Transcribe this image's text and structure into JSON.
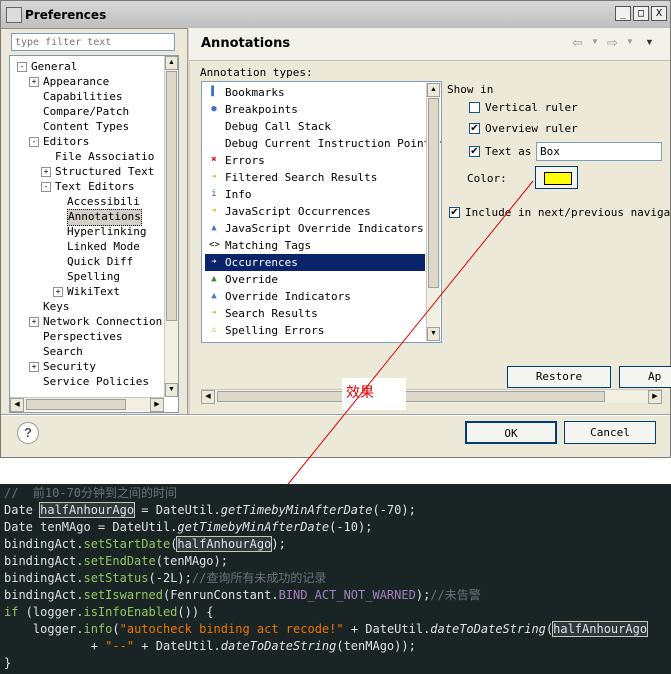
{
  "window": {
    "title": "Preferences",
    "minimize_label": "_",
    "maximize_label": "□",
    "close_label": "X"
  },
  "filter": {
    "placeholder": "type filter text"
  },
  "tree": {
    "items": [
      {
        "label": "General",
        "indent": 1,
        "toggle": "-"
      },
      {
        "label": "Appearance",
        "indent": 2,
        "toggle": "+"
      },
      {
        "label": "Capabilities",
        "indent": 2,
        "toggle": ""
      },
      {
        "label": "Compare/Patch",
        "indent": 2,
        "toggle": ""
      },
      {
        "label": "Content Types",
        "indent": 2,
        "toggle": ""
      },
      {
        "label": "Editors",
        "indent": 2,
        "toggle": "-"
      },
      {
        "label": "File Associatio",
        "indent": 3,
        "toggle": ""
      },
      {
        "label": "Structured Text",
        "indent": 3,
        "toggle": "+"
      },
      {
        "label": "Text Editors",
        "indent": 3,
        "toggle": "-"
      },
      {
        "label": "Accessibili",
        "indent": 4,
        "toggle": ""
      },
      {
        "label": "Annotations",
        "indent": 4,
        "toggle": "",
        "selected": true
      },
      {
        "label": "Hyperlinking",
        "indent": 4,
        "toggle": ""
      },
      {
        "label": "Linked Mode",
        "indent": 4,
        "toggle": ""
      },
      {
        "label": "Quick Diff",
        "indent": 4,
        "toggle": ""
      },
      {
        "label": "Spelling",
        "indent": 4,
        "toggle": ""
      },
      {
        "label": "WikiText",
        "indent": 4,
        "toggle": "+"
      },
      {
        "label": "Keys",
        "indent": 2,
        "toggle": ""
      },
      {
        "label": "Network Connection",
        "indent": 2,
        "toggle": "+"
      },
      {
        "label": "Perspectives",
        "indent": 2,
        "toggle": ""
      },
      {
        "label": "Search",
        "indent": 2,
        "toggle": ""
      },
      {
        "label": "Security",
        "indent": 2,
        "toggle": "+"
      },
      {
        "label": "Service Policies",
        "indent": 2,
        "toggle": ""
      }
    ]
  },
  "page": {
    "title": "Annotations"
  },
  "annotation_types": {
    "label": "Annotation types:",
    "items": [
      {
        "label": "Bookmarks",
        "icon": "bookmark-icon",
        "glyph": "▌",
        "color": "#3c6fc8"
      },
      {
        "label": "Breakpoints",
        "icon": "breakpoint-icon",
        "glyph": "●",
        "color": "#3c6fc8"
      },
      {
        "label": "Debug Call Stack",
        "icon": "",
        "glyph": "",
        "color": "#000000"
      },
      {
        "label": "Debug Current Instruction Pointer",
        "icon": "",
        "glyph": "",
        "color": "#000000"
      },
      {
        "label": "Errors",
        "icon": "error-icon",
        "glyph": "✖",
        "color": "#d42020"
      },
      {
        "label": "Filtered Search Results",
        "icon": "arrow-icon",
        "glyph": "➔",
        "color": "#e0a000"
      },
      {
        "label": "Info",
        "icon": "info-icon",
        "glyph": "i",
        "color": "#2a5db0"
      },
      {
        "label": "JavaScript Occurrences",
        "icon": "arrow-icon",
        "glyph": "➔",
        "color": "#e0a000"
      },
      {
        "label": "JavaScript Override Indicators",
        "icon": "triangle-icon",
        "glyph": "▲",
        "color": "#4a78c0"
      },
      {
        "label": "Matching Tags",
        "icon": "tag-brackets-icon",
        "glyph": "<>",
        "color": "#000000"
      },
      {
        "label": "Occurrences",
        "icon": "arrow-icon",
        "glyph": "➔",
        "color": "#707070",
        "selected": true
      },
      {
        "label": "Override",
        "icon": "triangle-icon",
        "glyph": "▲",
        "color": "#2f8f2f"
      },
      {
        "label": "Override Indicators",
        "icon": "triangle-icon",
        "glyph": "▲",
        "color": "#4a78c0"
      },
      {
        "label": "Search Results",
        "icon": "arrow-icon",
        "glyph": "➔",
        "color": "#e0a000"
      },
      {
        "label": "Spelling Errors",
        "icon": "warning-icon",
        "glyph": "⚠",
        "color": "#d0a000"
      }
    ]
  },
  "options": {
    "show_in": "Show in",
    "vertical_ruler": {
      "label": "Vertical ruler",
      "checked": false
    },
    "overview_ruler": {
      "label": "Overview ruler",
      "checked": true
    },
    "text_as": {
      "label": "Text as",
      "checked": true,
      "value": "Box"
    },
    "color_label": "Color:",
    "color_value": "#ffff00",
    "include_next_prev": {
      "label": "Include in next/previous navigati",
      "checked": true
    }
  },
  "buttons": {
    "restore_defaults": "Restore Defaults",
    "apply": "Ap",
    "ok": "OK",
    "cancel": "Cancel",
    "help": "?"
  },
  "annotation_note": "效果",
  "code": {
    "lines": [
      [
        {
          "t": "//  前10-70分钟到之间的时间",
          "c": "cm"
        }
      ],
      [
        {
          "t": "Date "
        },
        {
          "t": "halfAnhourAgo",
          "c": "hl"
        },
        {
          "t": " = DateUtil."
        },
        {
          "t": "getTimebyMinAfterDate",
          "c": "it"
        },
        {
          "t": "(-70);"
        }
      ],
      [
        {
          "t": "Date tenMAgo = DateUtil."
        },
        {
          "t": "getTimebyMinAfterDate",
          "c": "it"
        },
        {
          "t": "(-10);"
        }
      ],
      [
        {
          "t": "bindingAct."
        },
        {
          "t": "setStartDate",
          "c": "fn"
        },
        {
          "t": "("
        },
        {
          "t": "halfAnhourAgo",
          "c": "hl"
        },
        {
          "t": ");"
        }
      ],
      [
        {
          "t": "bindingAct."
        },
        {
          "t": "setEndDate",
          "c": "fn"
        },
        {
          "t": "(tenMAgo);"
        }
      ],
      [
        {
          "t": "bindingAct."
        },
        {
          "t": "setStatus",
          "c": "fn"
        },
        {
          "t": "(-2L);"
        },
        {
          "t": "//查询所有未成功的记录",
          "c": "cm"
        }
      ],
      [
        {
          "t": "bindingAct."
        },
        {
          "t": "setIswarned",
          "c": "fn"
        },
        {
          "t": "(FenrunConstant."
        },
        {
          "t": "BIND_ACT_NOT_WARNED",
          "c": "cst"
        },
        {
          "t": ");"
        },
        {
          "t": "//未告警",
          "c": "cm"
        }
      ],
      [
        {
          "t": "if",
          "c": "kw"
        },
        {
          "t": " (logger."
        },
        {
          "t": "isInfoEnabled",
          "c": "fn"
        },
        {
          "t": "()) {"
        }
      ],
      [
        {
          "t": "    logger."
        },
        {
          "t": "info",
          "c": "fn"
        },
        {
          "t": "("
        },
        {
          "t": "\"autocheck binding act recode!\"",
          "c": "st"
        },
        {
          "t": " + DateUtil."
        },
        {
          "t": "dateToDateString",
          "c": "it"
        },
        {
          "t": "("
        },
        {
          "t": "halfAnhourAgo",
          "c": "hl"
        }
      ],
      [
        {
          "t": "            + "
        },
        {
          "t": "\"--\"",
          "c": "st"
        },
        {
          "t": " + DateUtil."
        },
        {
          "t": "dateToDateString",
          "c": "it"
        },
        {
          "t": "(tenMAgo));"
        }
      ],
      [
        {
          "t": "}"
        }
      ]
    ]
  }
}
